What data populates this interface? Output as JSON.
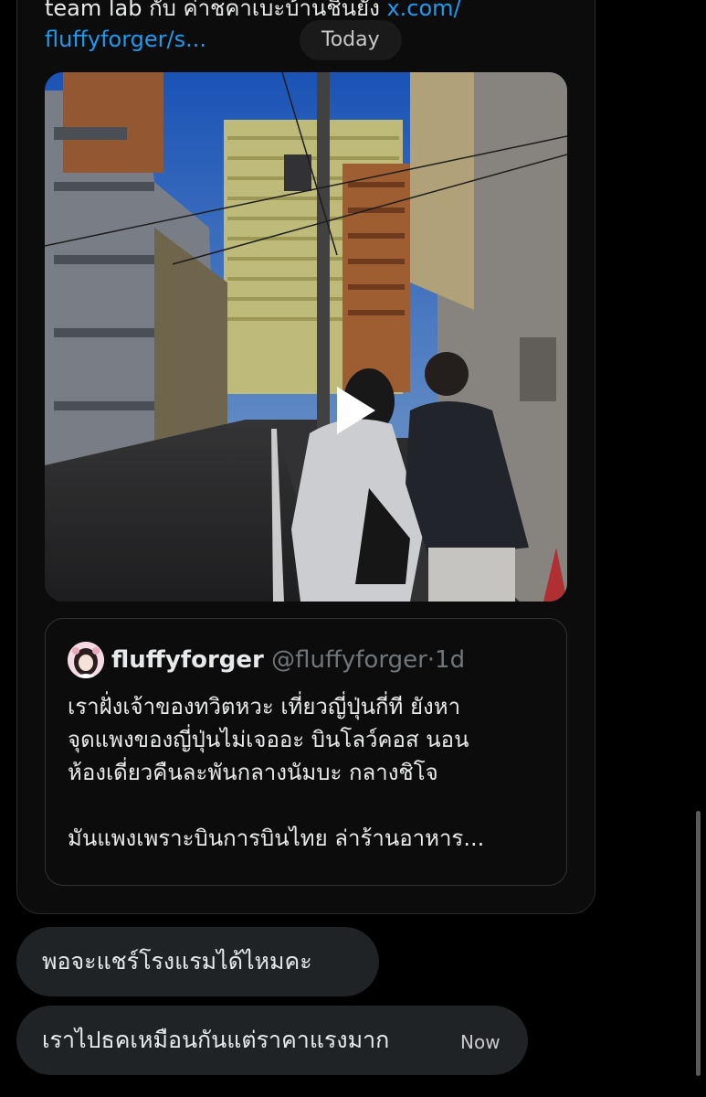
{
  "header": {
    "text_before_link": "team lab กับ ค่าชคาเบะบ้านชินยัง ",
    "link_part1": "x.com/",
    "link_part2": "fluffyforger/s..."
  },
  "date_separator": "Today",
  "video": {
    "icon": "play-icon",
    "sky_color": "#2f72d8"
  },
  "quote": {
    "display_name": "fluffyforger",
    "handle": "@fluffyforger",
    "separator": "·",
    "time": "1d",
    "body_lines": [
      "เราฝั่งเจ้าของทวิตหวะ เที่ยวญี่ปุ่นกี่ที ยังหา",
      "จุดแพงของญี่ปุ่นไม่เจออะ บินโลว์คอส นอน",
      "ห้องเดี่ยวคืนละพันกลางนัมบะ กลางชิโจ"
    ],
    "body_last": "มันแพงเพราะบินการบินไทย ล่าร้านอาหาร..."
  },
  "messages": [
    {
      "text": "พอจะแชร์โรงแรมได้ไหมคะ"
    },
    {
      "text": "เราไปธคเหมือนกันแต่ราคาแรงมาก",
      "time": "Now"
    }
  ],
  "colors": {
    "link": "#1d9bf0",
    "bubble": "#202326",
    "background": "#000000"
  }
}
